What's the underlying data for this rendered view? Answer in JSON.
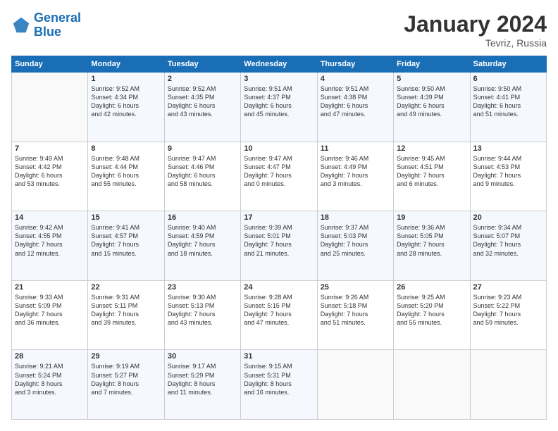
{
  "header": {
    "logo_line1": "General",
    "logo_line2": "Blue",
    "month_title": "January 2024",
    "location": "Tevriz, Russia"
  },
  "days_of_week": [
    "Sunday",
    "Monday",
    "Tuesday",
    "Wednesday",
    "Thursday",
    "Friday",
    "Saturday"
  ],
  "weeks": [
    [
      {
        "day": "",
        "info": ""
      },
      {
        "day": "1",
        "info": "Sunrise: 9:52 AM\nSunset: 4:34 PM\nDaylight: 6 hours\nand 42 minutes."
      },
      {
        "day": "2",
        "info": "Sunrise: 9:52 AM\nSunset: 4:35 PM\nDaylight: 6 hours\nand 43 minutes."
      },
      {
        "day": "3",
        "info": "Sunrise: 9:51 AM\nSunset: 4:37 PM\nDaylight: 6 hours\nand 45 minutes."
      },
      {
        "day": "4",
        "info": "Sunrise: 9:51 AM\nSunset: 4:38 PM\nDaylight: 6 hours\nand 47 minutes."
      },
      {
        "day": "5",
        "info": "Sunrise: 9:50 AM\nSunset: 4:39 PM\nDaylight: 6 hours\nand 49 minutes."
      },
      {
        "day": "6",
        "info": "Sunrise: 9:50 AM\nSunset: 4:41 PM\nDaylight: 6 hours\nand 51 minutes."
      }
    ],
    [
      {
        "day": "7",
        "info": "Sunrise: 9:49 AM\nSunset: 4:42 PM\nDaylight: 6 hours\nand 53 minutes."
      },
      {
        "day": "8",
        "info": "Sunrise: 9:48 AM\nSunset: 4:44 PM\nDaylight: 6 hours\nand 55 minutes."
      },
      {
        "day": "9",
        "info": "Sunrise: 9:47 AM\nSunset: 4:46 PM\nDaylight: 6 hours\nand 58 minutes."
      },
      {
        "day": "10",
        "info": "Sunrise: 9:47 AM\nSunset: 4:47 PM\nDaylight: 7 hours\nand 0 minutes."
      },
      {
        "day": "11",
        "info": "Sunrise: 9:46 AM\nSunset: 4:49 PM\nDaylight: 7 hours\nand 3 minutes."
      },
      {
        "day": "12",
        "info": "Sunrise: 9:45 AM\nSunset: 4:51 PM\nDaylight: 7 hours\nand 6 minutes."
      },
      {
        "day": "13",
        "info": "Sunrise: 9:44 AM\nSunset: 4:53 PM\nDaylight: 7 hours\nand 9 minutes."
      }
    ],
    [
      {
        "day": "14",
        "info": "Sunrise: 9:42 AM\nSunset: 4:55 PM\nDaylight: 7 hours\nand 12 minutes."
      },
      {
        "day": "15",
        "info": "Sunrise: 9:41 AM\nSunset: 4:57 PM\nDaylight: 7 hours\nand 15 minutes."
      },
      {
        "day": "16",
        "info": "Sunrise: 9:40 AM\nSunset: 4:59 PM\nDaylight: 7 hours\nand 18 minutes."
      },
      {
        "day": "17",
        "info": "Sunrise: 9:39 AM\nSunset: 5:01 PM\nDaylight: 7 hours\nand 21 minutes."
      },
      {
        "day": "18",
        "info": "Sunrise: 9:37 AM\nSunset: 5:03 PM\nDaylight: 7 hours\nand 25 minutes."
      },
      {
        "day": "19",
        "info": "Sunrise: 9:36 AM\nSunset: 5:05 PM\nDaylight: 7 hours\nand 28 minutes."
      },
      {
        "day": "20",
        "info": "Sunrise: 9:34 AM\nSunset: 5:07 PM\nDaylight: 7 hours\nand 32 minutes."
      }
    ],
    [
      {
        "day": "21",
        "info": "Sunrise: 9:33 AM\nSunset: 5:09 PM\nDaylight: 7 hours\nand 36 minutes."
      },
      {
        "day": "22",
        "info": "Sunrise: 9:31 AM\nSunset: 5:11 PM\nDaylight: 7 hours\nand 39 minutes."
      },
      {
        "day": "23",
        "info": "Sunrise: 9:30 AM\nSunset: 5:13 PM\nDaylight: 7 hours\nand 43 minutes."
      },
      {
        "day": "24",
        "info": "Sunrise: 9:28 AM\nSunset: 5:15 PM\nDaylight: 7 hours\nand 47 minutes."
      },
      {
        "day": "25",
        "info": "Sunrise: 9:26 AM\nSunset: 5:18 PM\nDaylight: 7 hours\nand 51 minutes."
      },
      {
        "day": "26",
        "info": "Sunrise: 9:25 AM\nSunset: 5:20 PM\nDaylight: 7 hours\nand 55 minutes."
      },
      {
        "day": "27",
        "info": "Sunrise: 9:23 AM\nSunset: 5:22 PM\nDaylight: 7 hours\nand 59 minutes."
      }
    ],
    [
      {
        "day": "28",
        "info": "Sunrise: 9:21 AM\nSunset: 5:24 PM\nDaylight: 8 hours\nand 3 minutes."
      },
      {
        "day": "29",
        "info": "Sunrise: 9:19 AM\nSunset: 5:27 PM\nDaylight: 8 hours\nand 7 minutes."
      },
      {
        "day": "30",
        "info": "Sunrise: 9:17 AM\nSunset: 5:29 PM\nDaylight: 8 hours\nand 11 minutes."
      },
      {
        "day": "31",
        "info": "Sunrise: 9:15 AM\nSunset: 5:31 PM\nDaylight: 8 hours\nand 16 minutes."
      },
      {
        "day": "",
        "info": ""
      },
      {
        "day": "",
        "info": ""
      },
      {
        "day": "",
        "info": ""
      }
    ]
  ]
}
